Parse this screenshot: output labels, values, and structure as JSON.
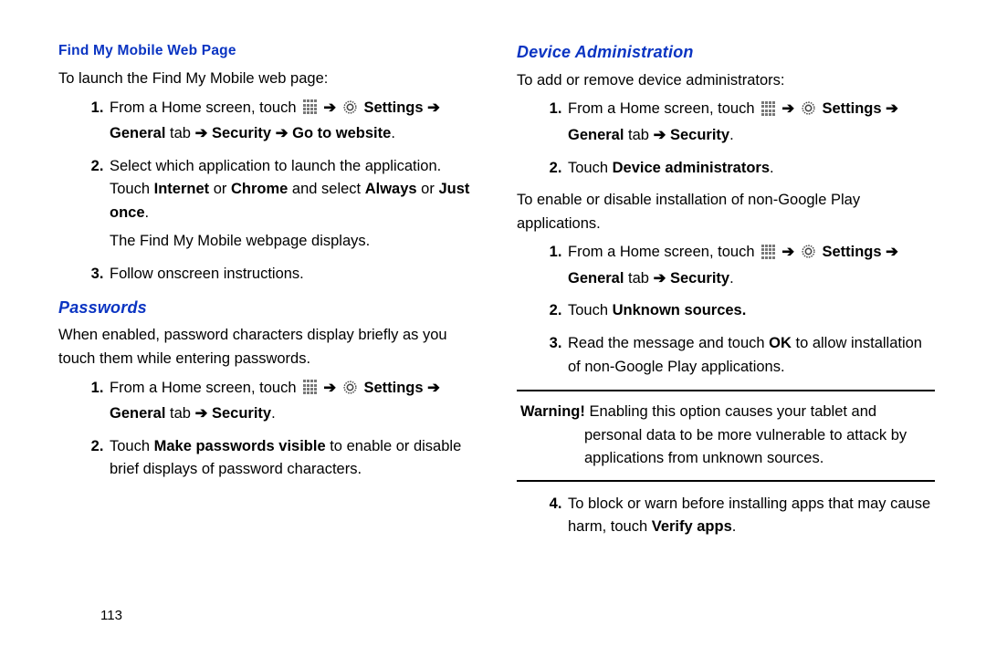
{
  "page_number": "113",
  "left": {
    "h_find": "Find My Mobile Web Page",
    "p_find_intro": "To launch the Find My Mobile web page:",
    "s1_a": "From a Home screen, touch ",
    "settings_lbl": "Settings",
    "general_lbl": "General",
    "tab_word": " tab ",
    "security_lbl": "Security",
    "goto_lbl": "Go to website",
    "s2_a": "Select which application to launch the application. Touch ",
    "internet_lbl": "Internet",
    "or_word": " or ",
    "chrome_lbl": "Chrome",
    "and_select": " and select ",
    "always_lbl": "Always",
    "just_once_lbl": "Just once",
    "s2_tail": "The Find My Mobile webpage displays.",
    "s3": "Follow onscreen instructions.",
    "h_pw": "Passwords",
    "p_pw_intro": "When enabled, password characters display briefly as you touch them while entering passwords.",
    "pw_s2_a": "Touch ",
    "make_pw_lbl": "Make passwords visible",
    "pw_s2_b": " to enable or disable brief displays of password characters."
  },
  "right": {
    "h_dev": "Device Administration",
    "p_dev_intro": "To add or remove device administrators:",
    "dev_s2_a": "Touch ",
    "dev_admin_lbl": "Device administrators",
    "p_nonplay_intro": "To enable or disable installation of non-Google Play applications.",
    "unk_src_lbl": "Unknown sources.",
    "s3_a": "Read the message and touch ",
    "ok_lbl": "OK",
    "s3_b": " to allow installation of non-Google Play applications.",
    "warn_lbl": "Warning!",
    "warn_first": " Enabling this option causes your tablet and",
    "warn_rest": "personal data to be more vulnerable to attack by applications from unknown sources.",
    "s4_a": "To block or warn before installing apps that may cause harm, touch ",
    "verify_lbl": "Verify apps"
  },
  "glyphs": {
    "arrow": "➔",
    "period": "."
  }
}
